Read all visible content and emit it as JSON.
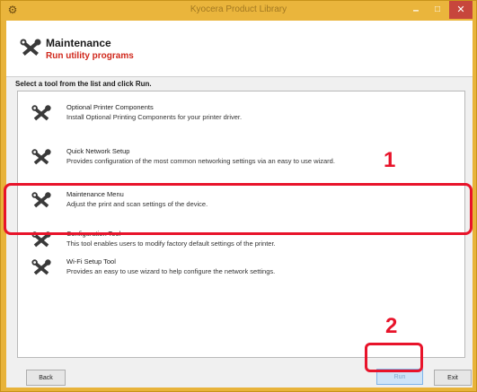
{
  "window": {
    "title": "Kyocera Product Library",
    "minimize_glyph": "–",
    "maximize_glyph": "□",
    "close_glyph": "✕"
  },
  "header": {
    "title": "Maintenance",
    "subtitle": "Run utility programs",
    "icon": "tools-icon"
  },
  "instruction": "Select a tool from the list and click Run.",
  "tools": [
    {
      "name": "Optional Printer Components",
      "description": "Install Optional Printing Components for your printer driver."
    },
    {
      "name": "Quick Network Setup",
      "description": "Provides configuration of the most common networking settings via an easy to use wizard."
    },
    {
      "name": "Maintenance Menu",
      "description": "Adjust the print and scan settings of the device."
    },
    {
      "name": "Configuration Tool",
      "description": "This tool enables users to modify factory default settings of the printer."
    },
    {
      "name": "Wi-Fi Setup Tool",
      "description": "Provides an easy to use wizard to help configure the network settings."
    }
  ],
  "buttons": {
    "back": "Back",
    "run": "Run",
    "exit": "Exit"
  },
  "callouts": {
    "step1": "1",
    "step2": "2"
  },
  "colors": {
    "titlebar": "#eab53c",
    "accent_red": "#e8132a",
    "subtitle_red": "#d0281c"
  }
}
